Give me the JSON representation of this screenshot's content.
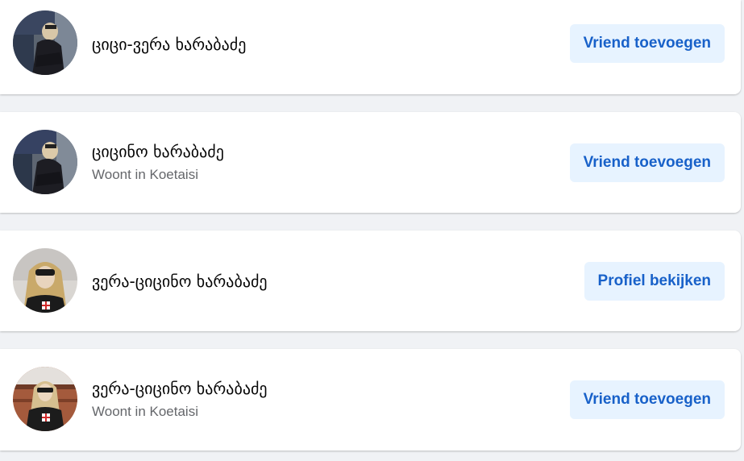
{
  "results": [
    {
      "name": "ციცი-ვერა ხარაბაძე",
      "subtitle": "",
      "button_label": "Vriend toevoegen"
    },
    {
      "name": "ციცინო ხარაბაძე",
      "subtitle": "Woont in Koetaisi",
      "button_label": "Vriend toevoegen"
    },
    {
      "name": "ვერა-ციცინო ხარაბაძე",
      "subtitle": "",
      "button_label": "Profiel bekijken"
    },
    {
      "name": "ვერა-ციცინო ხარაბაძე",
      "subtitle": "Woont in Koetaisi",
      "button_label": "Vriend toevoegen"
    }
  ],
  "colors": {
    "page_background": "#f0f2f5",
    "card_background": "#ffffff",
    "button_background": "#e7f3ff",
    "button_text": "#1861c9",
    "name_text": "#050505",
    "subtitle_text": "#65676b"
  }
}
